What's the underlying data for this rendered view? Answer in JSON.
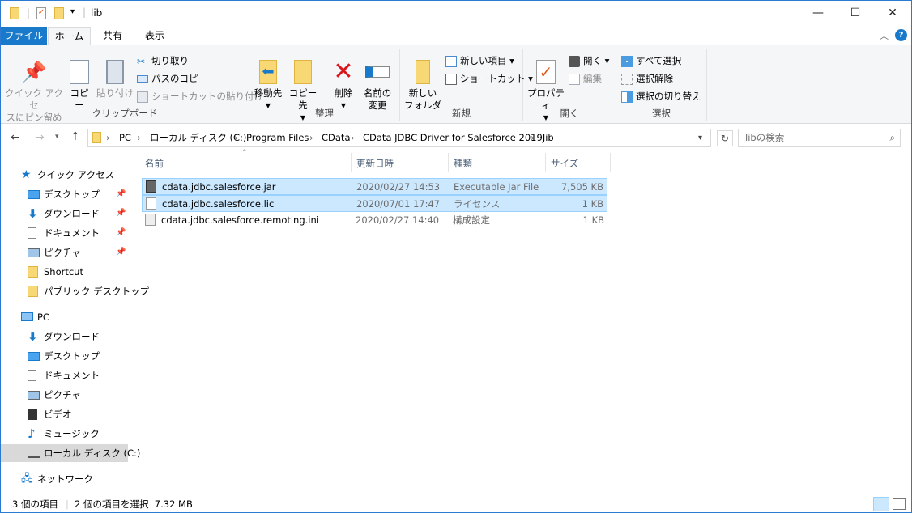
{
  "window": {
    "title": "lib",
    "minimize": "—",
    "maximize": "☐",
    "close": "✕"
  },
  "tabs": {
    "file": "ファイル",
    "home": "ホーム",
    "share": "共有",
    "view": "表示"
  },
  "ribbon": {
    "clipboard": {
      "label": "クリップボード",
      "pin_line1": "クイック アクセ",
      "pin_line2": "スにピン留め",
      "copy": "コピー",
      "paste": "貼り付け",
      "cut": "切り取り",
      "copy_path": "パスのコピー",
      "paste_shortcut": "ショートカットの貼り付け"
    },
    "organize": {
      "label": "整理",
      "move_to": "移動先",
      "copy_to": "コピー先",
      "delete": "削除",
      "rename_line1": "名前の",
      "rename_line2": "変更"
    },
    "new": {
      "label": "新規",
      "new_folder_line1": "新しい",
      "new_folder_line2": "フォルダー",
      "new_item": "新しい項目 ▾",
      "easy_access": "ショートカット ▾"
    },
    "open": {
      "label": "開く",
      "properties": "プロパティ",
      "open": "開く ▾",
      "edit": "編集"
    },
    "select": {
      "label": "選択",
      "select_all": "すべて選択",
      "select_none": "選択解除",
      "invert": "選択の切り替え"
    }
  },
  "address": {
    "crumbs": [
      "PC",
      "ローカル ディスク (C:)",
      "Program Files",
      "CData",
      "CData JDBC Driver for Salesforce 2019J",
      "lib"
    ],
    "search_placeholder": "libの検索"
  },
  "sidebar": {
    "items": [
      {
        "label": "クイック アクセス",
        "icon": "star"
      },
      {
        "label": "デスクトップ",
        "icon": "desktop",
        "pinned": true
      },
      {
        "label": "ダウンロード",
        "icon": "download",
        "pinned": true
      },
      {
        "label": "ドキュメント",
        "icon": "document",
        "pinned": true
      },
      {
        "label": "ピクチャ",
        "icon": "picture",
        "pinned": true
      },
      {
        "label": "Shortcut",
        "icon": "folder"
      },
      {
        "label": "パブリック デスクトップ",
        "icon": "folder"
      },
      {
        "label": "PC",
        "icon": "pc"
      },
      {
        "label": "ダウンロード",
        "icon": "download"
      },
      {
        "label": "デスクトップ",
        "icon": "desktop"
      },
      {
        "label": "ドキュメント",
        "icon": "document"
      },
      {
        "label": "ピクチャ",
        "icon": "picture"
      },
      {
        "label": "ビデオ",
        "icon": "video"
      },
      {
        "label": "ミュージック",
        "icon": "music"
      },
      {
        "label": "ローカル ディスク (C:)",
        "icon": "drive",
        "selected": true
      },
      {
        "label": "ネットワーク",
        "icon": "network"
      }
    ]
  },
  "columns": {
    "name": "名前",
    "date": "更新日時",
    "type": "種類",
    "size": "サイズ"
  },
  "files": [
    {
      "name": "cdata.jdbc.salesforce.jar",
      "date": "2020/02/27 14:53",
      "type": "Executable Jar File",
      "size": "7,505 KB",
      "selected": true
    },
    {
      "name": "cdata.jdbc.salesforce.lic",
      "date": "2020/07/01 17:47",
      "type": "ライセンス",
      "size": "1 KB",
      "selected": true
    },
    {
      "name": "cdata.jdbc.salesforce.remoting.ini",
      "date": "2020/02/27 14:40",
      "type": "構成設定",
      "size": "1 KB",
      "selected": false
    }
  ],
  "status": {
    "count": "3 個の項目",
    "selection": "2 個の項目を選択  7.32 MB"
  },
  "colors": {
    "accent": "#1979ca",
    "selection": "#cce8ff",
    "selection_border": "#99d1ff"
  }
}
